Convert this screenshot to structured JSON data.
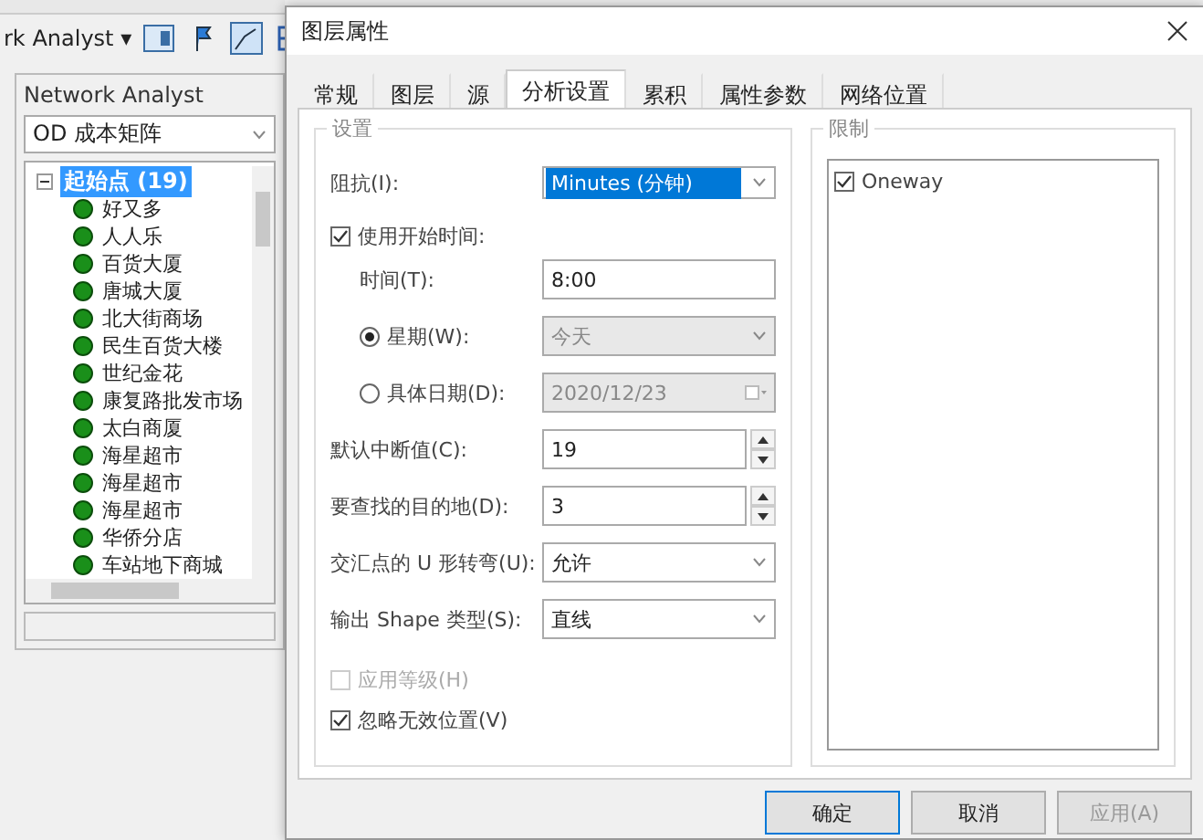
{
  "toolbar": {
    "label": "rk Analyst ▾"
  },
  "panel": {
    "title": "Network Analyst",
    "analysis": "OD 成本矩阵",
    "group": {
      "label": "起始点 (19)",
      "expanded": true,
      "selected": true
    },
    "items": [
      "好又多",
      "人人乐",
      "百货大厦",
      "唐城大厦",
      "北大街商场",
      "民生百货大楼",
      "世纪金花",
      "康复路批发市场",
      "太白商厦",
      "海星超市",
      "海星超市",
      "海星超市",
      "华侨分店",
      "车站地下商城"
    ]
  },
  "dialog": {
    "title": "图层属性",
    "tabs": [
      {
        "label": "常规",
        "selected": false
      },
      {
        "label": "图层",
        "selected": false
      },
      {
        "label": "源",
        "selected": false
      },
      {
        "label": "分析设置",
        "selected": true
      },
      {
        "label": "累积",
        "selected": false
      },
      {
        "label": "属性参数",
        "selected": false
      },
      {
        "label": "网络位置",
        "selected": false
      }
    ],
    "settings_title": "设置",
    "impedance": {
      "label": "阻抗(I):",
      "value": "Minutes (分钟)"
    },
    "use_start_time": {
      "label": "使用开始时间:",
      "checked": true
    },
    "time": {
      "label": "时间(T):",
      "value": "8:00"
    },
    "day_options": [
      {
        "label": "星期(W):",
        "selected": true,
        "value": "今天",
        "kind": "select",
        "disabled": true
      },
      {
        "label": "具体日期(D):",
        "selected": false,
        "value": "2020/12/23",
        "kind": "date",
        "disabled": true
      }
    ],
    "fields": [
      {
        "label": "默认中断值(C):",
        "value": "19",
        "kind": "spin"
      },
      {
        "label": "要查找的目的地(D):",
        "value": "3",
        "kind": "spin"
      },
      {
        "label": "交汇点的 U 形转弯(U):",
        "value": "允许",
        "kind": "select"
      },
      {
        "label": "输出 Shape 类型(S):",
        "value": "直线",
        "kind": "select"
      }
    ],
    "checks": [
      {
        "label": "应用等级(H)",
        "checked": false,
        "disabled": true
      },
      {
        "label": "忽略无效位置(V)",
        "checked": true,
        "disabled": false
      }
    ],
    "restrictions_title": "限制",
    "restrictions": [
      {
        "label": "Oneway",
        "checked": true
      }
    ],
    "buttons": [
      {
        "label": "确定",
        "disabled": false,
        "default": true
      },
      {
        "label": "取消",
        "disabled": false,
        "default": false
      },
      {
        "label": "应用(A)",
        "disabled": true,
        "default": false
      }
    ]
  }
}
